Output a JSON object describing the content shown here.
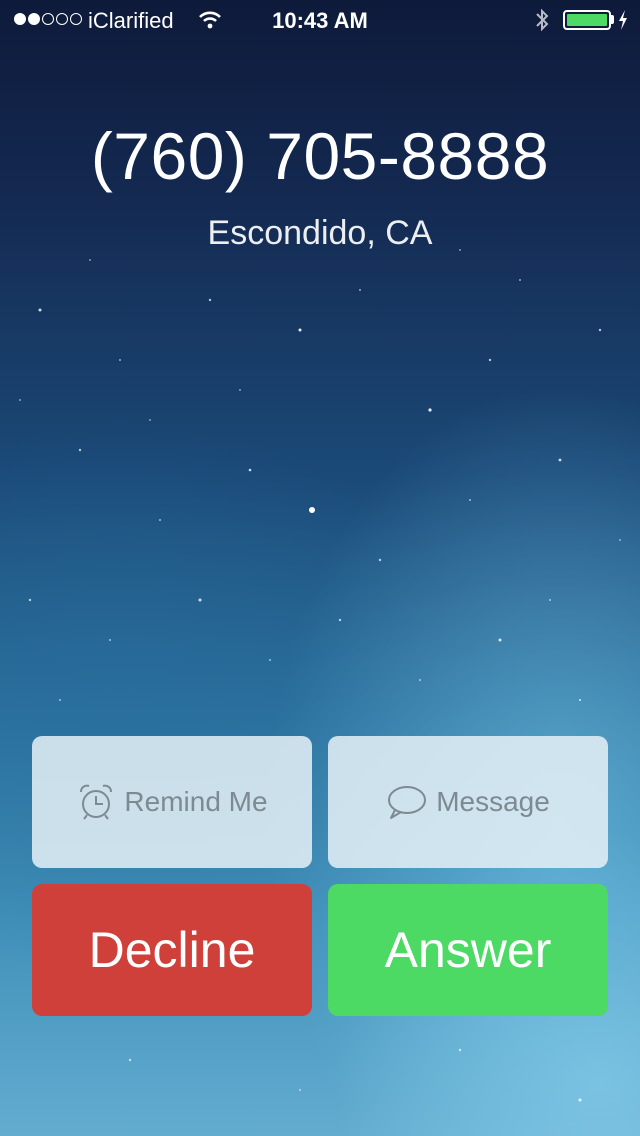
{
  "status_bar": {
    "carrier": "iClarified",
    "signal_strength": 2,
    "signal_max": 5,
    "time": "10:43 AM",
    "battery_level": 1.0,
    "icons": [
      "wifi-icon",
      "bluetooth-icon",
      "battery-icon",
      "charging-icon"
    ]
  },
  "caller": {
    "number": "(760) 705-8888",
    "location": "Escondido, CA"
  },
  "actions": {
    "remind_label": "Remind Me",
    "message_label": "Message",
    "decline_label": "Decline",
    "answer_label": "Answer"
  },
  "colors": {
    "decline": "#d0403a",
    "answer": "#4cd964",
    "secondary_text": "#7d8a92"
  }
}
